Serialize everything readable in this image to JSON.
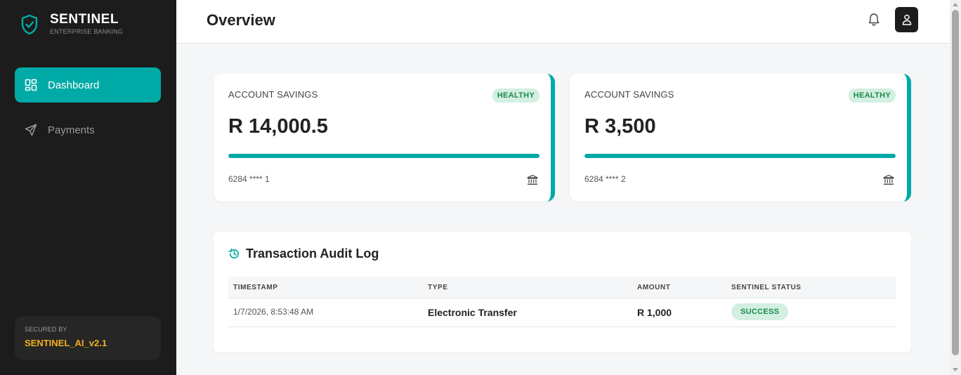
{
  "brand": {
    "title": "SENTINEL",
    "subtitle": "ENTERPRISE BANKING"
  },
  "nav": [
    {
      "label": "Dashboard",
      "icon": "grid-icon",
      "active": true
    },
    {
      "label": "Payments",
      "icon": "send-icon",
      "active": false
    }
  ],
  "secured": {
    "label": "SECURED BY",
    "value": "SENTINEL_AI_v2.1"
  },
  "header": {
    "title": "Overview"
  },
  "accounts": [
    {
      "label": "ACCOUNT SAVINGS",
      "badge": "HEALTHY",
      "amount": "R 14,000.5",
      "number": "6284 **** 1",
      "progress": 1.0
    },
    {
      "label": "ACCOUNT SAVINGS",
      "badge": "HEALTHY",
      "amount": "R 3,500",
      "number": "6284 **** 2",
      "progress": 1.0
    }
  ],
  "audit_log": {
    "title": "Transaction Audit Log",
    "columns": [
      "TIMESTAMP",
      "TYPE",
      "AMOUNT",
      "SENTINEL STATUS"
    ],
    "rows": [
      {
        "timestamp": "1/7/2026, 8:53:48 AM",
        "type": "Electronic Transfer",
        "amount": "R 1,000",
        "status": "SUCCESS"
      }
    ]
  },
  "colors": {
    "accent": "#00aaa6",
    "sidebar": "#1c1c1c",
    "healthy_bg": "#d3efe1",
    "healthy_text": "#1b8a4f",
    "secured_value": "#f2b01e"
  }
}
